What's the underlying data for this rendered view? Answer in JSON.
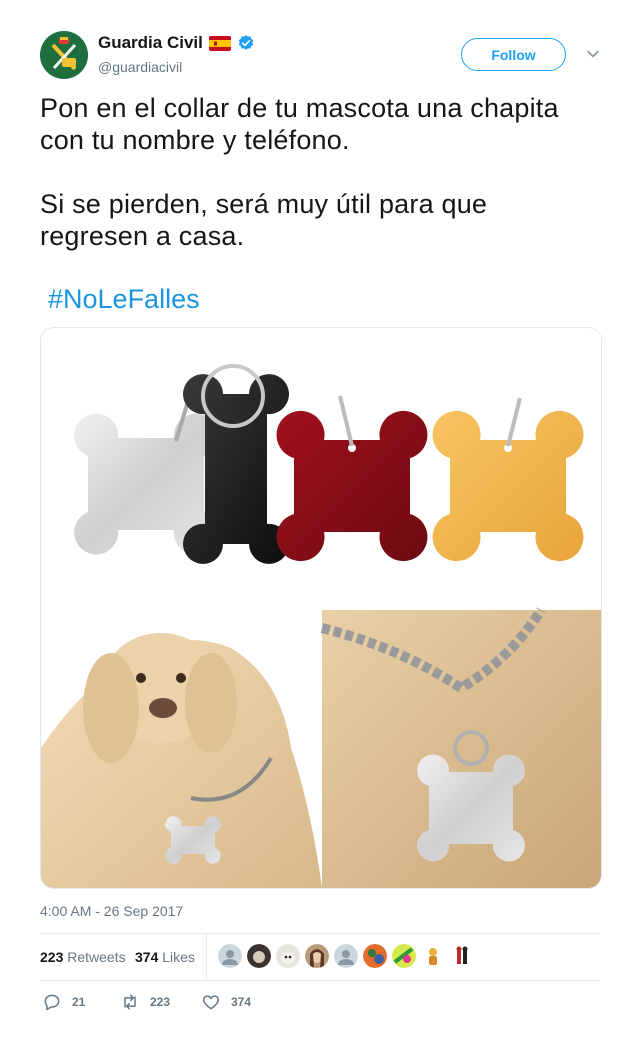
{
  "user": {
    "display_name": "Guardia Civil",
    "handle": "@guardiacivil",
    "follow_label": "Follow",
    "verified": true,
    "flag_icon": "spain-flag-icon"
  },
  "tweet": {
    "line1": "Pon en el collar de tu mascota una chapita con tu nombre y teléfono.",
    "line2": "Si se pierden, será muy útil para que regresen a casa.",
    "hashtag": "#NoLeFalles",
    "timestamp": "4:00 AM - 26 Sep 2017"
  },
  "stats": {
    "retweets_count": "223",
    "retweets_label": "Retweets",
    "likes_count": "374",
    "likes_label": "Likes"
  },
  "actions": {
    "reply_count": "21",
    "retweet_count": "223",
    "like_count": "374"
  },
  "colors": {
    "accent": "#1da1f2",
    "hashtag": "#1b95e0",
    "secondary_text": "#657786"
  }
}
